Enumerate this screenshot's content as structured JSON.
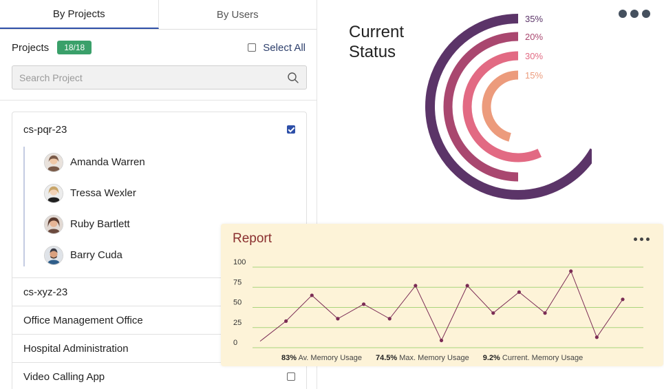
{
  "tabs": [
    {
      "label": "By Projects",
      "active": true
    },
    {
      "label": "By Users",
      "active": false
    }
  ],
  "projects_header": {
    "title": "Projects",
    "count": "18/18",
    "select_all_label": "Select All"
  },
  "search": {
    "placeholder": "Search Project",
    "value": ""
  },
  "expanded_project": {
    "name": "cs-pqr-23",
    "checked": true,
    "members": [
      {
        "name": "Amanda Warren",
        "avatar_color": "#7a5a48"
      },
      {
        "name": "Tressa Wexler",
        "avatar_color": "#c8a56a"
      },
      {
        "name": "Ruby Bartlett",
        "avatar_color": "#5a3a2e"
      },
      {
        "name": "Barry Cuda",
        "avatar_color": "#3a3a44"
      }
    ]
  },
  "projects": [
    {
      "name": "cs-xyz-23"
    },
    {
      "name": "Office Management Office"
    },
    {
      "name": "Hospital Administration"
    },
    {
      "name": "Video Calling App",
      "checked": false
    }
  ],
  "status": {
    "title": "Current\nStatus",
    "rings": [
      {
        "label": "35%",
        "value": 35,
        "color": "#5b3468"
      },
      {
        "label": "20%",
        "value": 20,
        "color": "#a9476f"
      },
      {
        "label": "30%",
        "value": 30,
        "color": "#e26a83"
      },
      {
        "label": "15%",
        "value": 15,
        "color": "#ec9b7c"
      }
    ]
  },
  "report": {
    "title": "Report",
    "stats": [
      {
        "value": "83%",
        "label": "Av. Memory Usage"
      },
      {
        "value": "74.5%",
        "label": "Max. Memory Usage"
      },
      {
        "value": "9.2%",
        "label": "Current. Memory Usage"
      }
    ],
    "chart_data": {
      "type": "line",
      "y_ticks": [
        100,
        75,
        50,
        25,
        0
      ],
      "ylim": [
        0,
        100
      ],
      "values": [
        8,
        33,
        65,
        36,
        54,
        36,
        77,
        9,
        77,
        43,
        69,
        43,
        95,
        13,
        60
      ],
      "line_color": "#7b2c55",
      "grid_color": "#a8d47a",
      "grid": true
    }
  }
}
